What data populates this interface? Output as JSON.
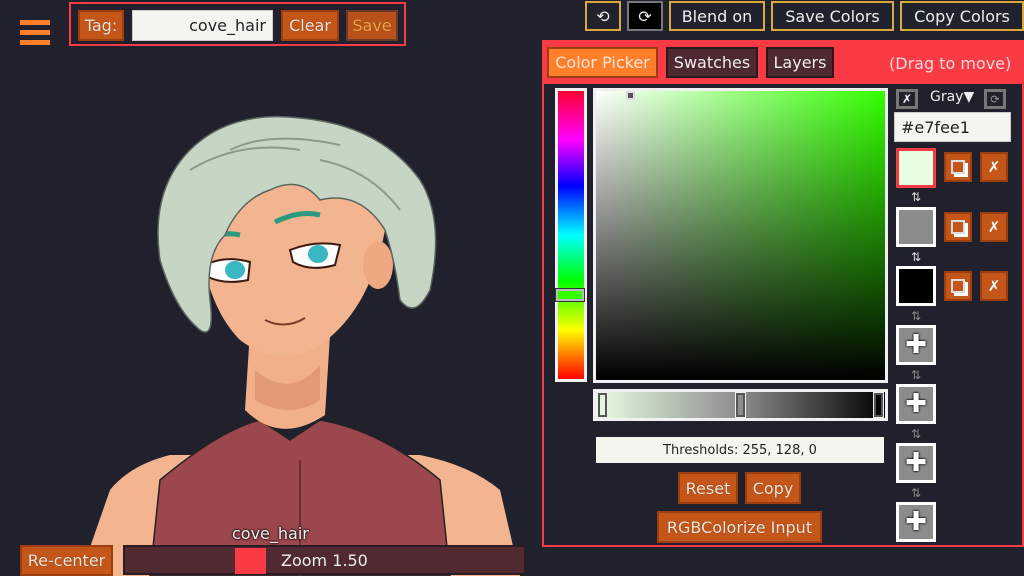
{
  "top_left": {
    "menu_icon": "hamburger-menu-icon",
    "tag_label": "Tag:",
    "tag_value": "cove_hair",
    "clear_label": "Clear",
    "save_label": "Save"
  },
  "top_right": {
    "undo_icon": "⟲",
    "redo_icon": "⟳",
    "blend_label": "Blend on",
    "save_colors_label": "Save Colors",
    "copy_colors_label": "Copy Colors"
  },
  "panel": {
    "tabs": [
      {
        "label": "Color Picker",
        "active": true
      },
      {
        "label": "Swatches",
        "active": false
      },
      {
        "label": "Layers",
        "active": false
      }
    ],
    "drag_hint": "(Drag to move)",
    "hue_color": "#33ff00",
    "mode_label": "Gray▼",
    "clear_icon": "✗",
    "refresh_icon": "⟳",
    "hex_value": "#e7fee1",
    "swatches": [
      {
        "color": "#e7fee1",
        "selected": true
      },
      {
        "color": "#8c8c8c",
        "selected": false
      },
      {
        "color": "#000000",
        "selected": false
      }
    ],
    "empty_slots": 4,
    "swap_icon": "⇅",
    "copy_icon": "copy-icon",
    "delete_icon": "✗",
    "add_icon": "✚",
    "thresholds_text": "Thresholds: 255, 128, 0",
    "reset_label": "Reset",
    "copy_label": "Copy",
    "rgbcolorize_label": "RGBColorize Input"
  },
  "bottom": {
    "layer_name": "cove_hair",
    "recenter_label": "Re-center",
    "zoom_label": "Zoom 1.50",
    "zoom_value": 1.5,
    "zoom_handle_color": "#fa3b45"
  },
  "colors": {
    "accent_red": "#fa3b45",
    "button_orange": "#c4561a",
    "active_tab_orange": "#ff7f2a",
    "border_gold": "#d9a93e",
    "background": "#21212d"
  }
}
